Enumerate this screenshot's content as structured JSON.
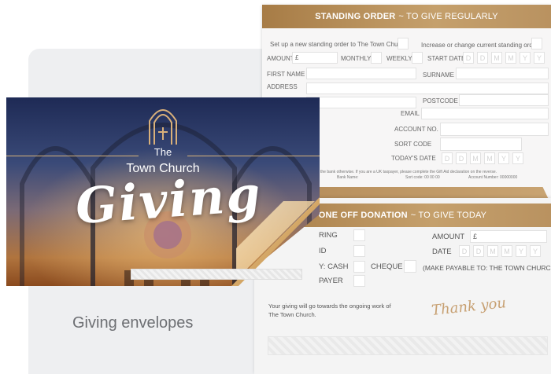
{
  "caption": "Giving envelopes",
  "standing_order": {
    "title_bold": "STANDING ORDER",
    "title_rest": "~ TO GIVE REGULARLY",
    "setup_text": "Set up a new standing order to The Town Church",
    "increase_text": "Increase or change current standing order",
    "amount": "AMOUNT",
    "currency": "£",
    "monthly": "MONTHLY",
    "weekly": "WEEKLY",
    "start_date": "START DATE",
    "date_chars": [
      "D",
      "D",
      "M",
      "M",
      "Y",
      "Y"
    ],
    "first_name": "FIRST NAME",
    "surname": "SURNAME",
    "address": "ADDRESS",
    "postcode": "POSTCODE",
    "email": "EMAIL",
    "account_no": "ACCOUNT NO.",
    "sort_code": "SORT CODE",
    "todays_date": "TODAY'S DATE",
    "fine_print": "the bank otherwise. If you are a UK taxpayer, please complete the Gift Aid declaration on the reverse.",
    "bank_name": "Bank Name:",
    "sort_small": "Sort code: 00 00 00",
    "account_small": "Account Number: 00000000"
  },
  "one_off": {
    "title_bold": "ONE OFF DONATION",
    "title_rest": "~ TO GIVE TODAY",
    "ring": "RING",
    "id_label": "ID",
    "by_cash": "Y: CASH",
    "cheque": "CHEQUE",
    "payer": "PAYER",
    "amount": "AMOUNT",
    "currency": "£",
    "date": "DATE",
    "date_chars": [
      "D",
      "D",
      "M",
      "M",
      "Y",
      "Y"
    ],
    "payable": "(MAKE PAYABLE TO: THE TOWN CHURCH)",
    "note": "Your giving will go towards the ongoing work of The Town Church.",
    "thanks": "Thank you"
  },
  "envelope": {
    "the": "The",
    "church": "Town Church",
    "giving": "Giving"
  }
}
